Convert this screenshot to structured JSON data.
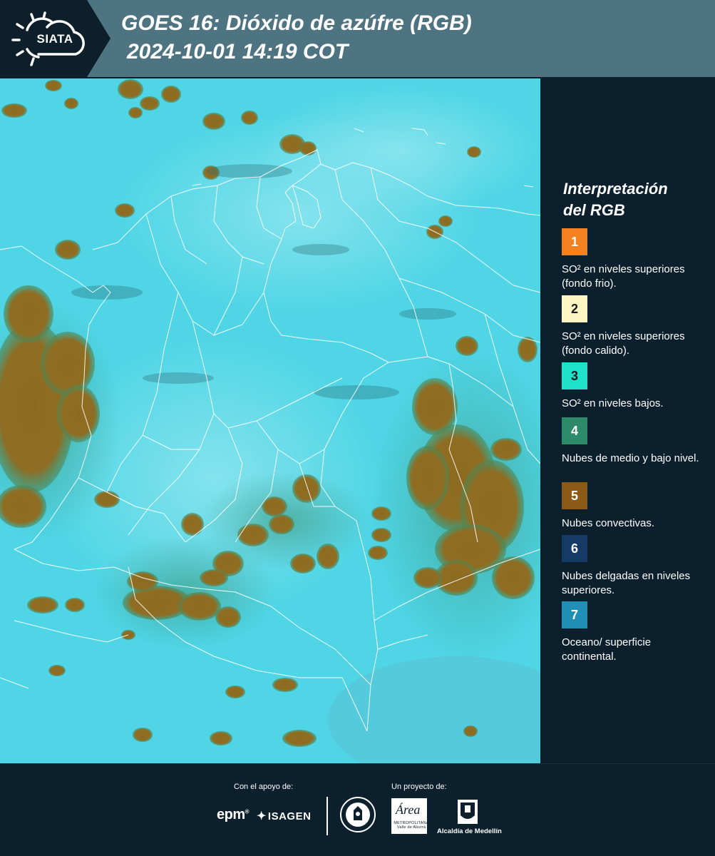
{
  "header": {
    "logo_text": "SIATA",
    "title": "GOES 16: Dióxido de azúfre (RGB)",
    "datetime": "2024-10-01 14:19 COT"
  },
  "legend": {
    "title_line1": "Interpretación",
    "title_line2": "del RGB",
    "items": [
      {
        "number": "1",
        "label": "SO² en niveles superiores (fondo frio).",
        "color": "#f58220",
        "text_color": "#ffffff"
      },
      {
        "number": "2",
        "label": "SO² en niveles superiores (fondo calido).",
        "color": "#fdf6c3",
        "text_color": "#1a1a1a"
      },
      {
        "number": "3",
        "label": "SO² en niveles bajos.",
        "color": "#1fe0c8",
        "text_color": "#1a1a1a"
      },
      {
        "number": "4",
        "label": "Nubes de medio y bajo nivel.",
        "color": "#2e8b6a",
        "text_color": "#ffffff"
      },
      {
        "number": "5",
        "label": "Nubes convectivas.",
        "color": "#8c5a17",
        "text_color": "#ffffff"
      },
      {
        "number": "6",
        "label": "Nubes delgadas en niveles superiores.",
        "color": "#163a66",
        "text_color": "#ffffff"
      },
      {
        "number": "7",
        "label": "Oceano/ superficie continental.",
        "color": "#1f8fb5",
        "text_color": "#ffffff"
      }
    ]
  },
  "map": {
    "background_color": "#4dd6e8",
    "cloud_color": "#8f6a1e",
    "border_color": "#ffffff"
  },
  "footer": {
    "support_label": "Con el apoyo de:",
    "project_label": "Un proyecto de:",
    "epm_text": "epm",
    "isagen_text": "ISAGEN",
    "area_text": "Área",
    "area_subtext": "METROPOLITANA Valle de Aburrá",
    "alcaldia_text": "Alcaldía de Medellín"
  }
}
